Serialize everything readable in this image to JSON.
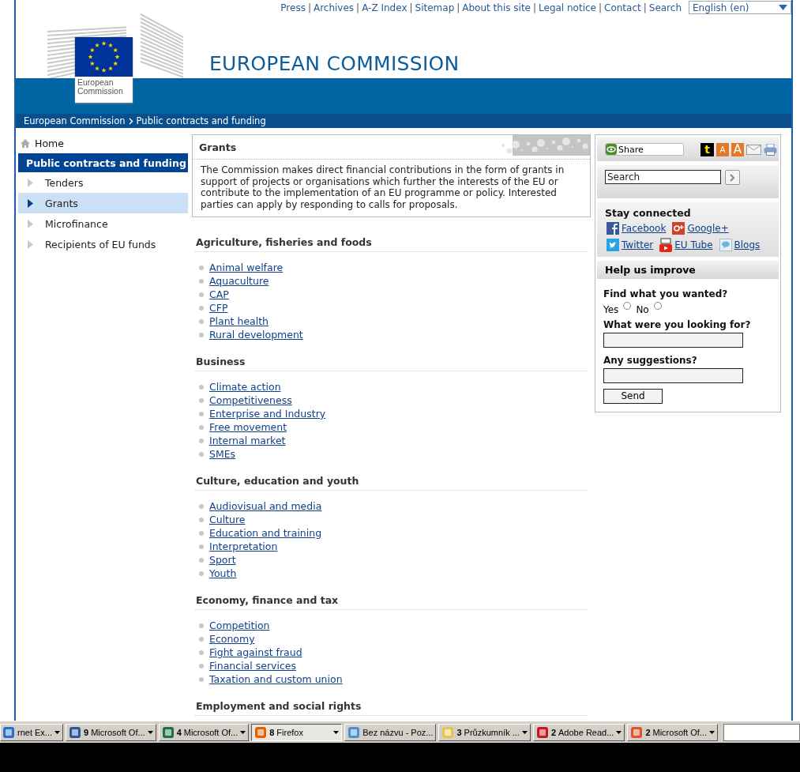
{
  "top_link_separator": "|",
  "top_links": [
    "Press",
    "Archives",
    "A-Z Index",
    "Sitemap",
    "About this site",
    "Legal notice",
    "Contact",
    "Search"
  ],
  "language_select": {
    "value": "English (en)"
  },
  "logo": {
    "caption": "European Commission"
  },
  "site_title": "EUROPEAN COMMISSION",
  "breadcrumb": [
    "European Commission",
    "Public contracts and funding"
  ],
  "left_nav": {
    "home": "Home",
    "section": "Public contracts and funding",
    "items": [
      {
        "label": "Tenders",
        "selected": false
      },
      {
        "label": "Grants",
        "selected": true
      },
      {
        "label": "Microfinance",
        "selected": false
      },
      {
        "label": "Recipients of EU funds",
        "selected": false
      }
    ]
  },
  "intro_box": {
    "title": "Grants",
    "text": "The Commission makes direct financial contributions in the form of grants in support of projects or organisations which further the interests of the EU or contribute to the implementation of an EU programme or policy. Interested parties can apply by responding to calls for proposals."
  },
  "sections": [
    {
      "heading": "Agriculture, fisheries and foods",
      "links": [
        "Animal welfare",
        "Aquaculture",
        "CAP",
        "CFP",
        "Plant health",
        "Rural development"
      ]
    },
    {
      "heading": "Business",
      "links": [
        "Climate action",
        "Competitiveness",
        "Enterprise and Industry",
        "Free movement",
        "Internal market",
        "SMEs"
      ]
    },
    {
      "heading": "Culture, education and youth",
      "links": [
        "Audiovisual and media",
        "Culture",
        "Education and training",
        "Interpretation",
        "Sport",
        "Youth"
      ]
    },
    {
      "heading": "Economy, finance and tax",
      "links": [
        "Competition",
        "Economy",
        "Fight against fraud",
        "Financial services",
        "Taxation and custom union"
      ]
    },
    {
      "heading": "Employment and social rights"
    }
  ],
  "sidebar": {
    "share": "Share",
    "tools": [
      {
        "kind": "letter",
        "label": "t"
      },
      {
        "kind": "font-small",
        "label": "A"
      },
      {
        "kind": "font-large",
        "label": "A"
      },
      {
        "kind": "email"
      },
      {
        "kind": "print"
      }
    ],
    "search": {
      "placeholder": "Search"
    },
    "stay_connected": {
      "heading": "Stay connected",
      "links": [
        {
          "kind": "facebook",
          "label": "Facebook"
        },
        {
          "kind": "googleplus",
          "label": "Google+"
        },
        {
          "kind": "twitter",
          "label": "Twitter"
        },
        {
          "kind": "youtube",
          "label": "EU Tube"
        },
        {
          "kind": "blogs",
          "label": "Blogs"
        }
      ]
    },
    "help": {
      "heading": "Help us improve",
      "question": "Find what you wanted?",
      "options": [
        {
          "label": "Yes",
          "checked": false
        },
        {
          "label": "No",
          "checked": false
        }
      ],
      "fields": [
        {
          "label": "What were you looking for?"
        },
        {
          "label": "Any suggestions?"
        }
      ],
      "button": "Send"
    }
  },
  "taskbar": {
    "items": [
      {
        "kind": "ie",
        "label": "rnet Ex...",
        "grouped": true,
        "selected": false
      },
      {
        "kind": "word",
        "count": "9",
        "label": "Microsoft Of...",
        "grouped": true,
        "selected": false
      },
      {
        "kind": "excel",
        "count": "4",
        "label": "Microsoft Of...",
        "grouped": true,
        "selected": false
      },
      {
        "kind": "firefox",
        "count": "8",
        "label": "Firefox",
        "grouped": true,
        "selected": true
      },
      {
        "kind": "paint",
        "label": "Bez názvu - Poz...",
        "grouped": false,
        "selected": false
      },
      {
        "kind": "folder",
        "count": "3",
        "label": "Průzkumník ...",
        "grouped": true,
        "selected": false
      },
      {
        "kind": "pdf",
        "count": "2",
        "label": "Adobe Read...",
        "grouped": true,
        "selected": false
      },
      {
        "kind": "office",
        "count": "2",
        "label": "Microsoft Of...",
        "grouped": true,
        "selected": false
      }
    ]
  }
}
